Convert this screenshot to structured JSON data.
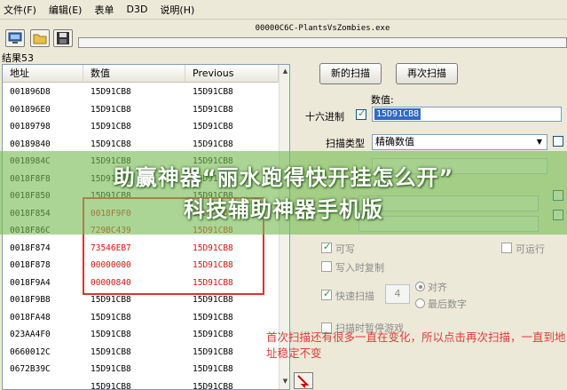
{
  "menu": [
    "文件(F)",
    "编辑(E)",
    "表单",
    "D3D",
    "说明(H)"
  ],
  "process_title": "00000C6C-PlantsVsZombies.exe",
  "result_count": "结果53",
  "columns": [
    "地址",
    "数值",
    "Previous"
  ],
  "rows": [
    [
      "001896D8",
      "15D91CB8",
      "15D91CB8"
    ],
    [
      "001896E0",
      "15D91CB8",
      "15D91CB8"
    ],
    [
      "00189798",
      "15D91CB8",
      "15D91CB8"
    ],
    [
      "00189840",
      "15D91CB8",
      "15D91CB8"
    ],
    [
      "0018984C",
      "15D91CB8",
      "15D91CB8"
    ],
    [
      "0018F8F8",
      "15D91CB8",
      "15D91CB8"
    ],
    [
      "0018F850",
      "15D91CB8",
      "15D91CB8"
    ],
    [
      "0018F854",
      "0018F9F0",
      "15D91CB8"
    ],
    [
      "0018F86C",
      "729BC439",
      "15D91CB8"
    ],
    [
      "0018F874",
      "73546EB7",
      "15D91CB8"
    ],
    [
      "0018F878",
      "00000000",
      "15D91CB8"
    ],
    [
      "0018F9A4",
      "00000840",
      "15D91CB8"
    ],
    [
      "0018F9B8",
      "15D91CB8",
      "15D91CB8"
    ],
    [
      "0018FA48",
      "15D91CB8",
      "15D91CB8"
    ],
    [
      "023AA4F0",
      "15D91CB8",
      "15D91CB8"
    ],
    [
      "0660012C",
      "15D91CB8",
      "15D91CB8"
    ],
    [
      "0672B39C",
      "15D91CB8",
      "15D91CB8"
    ],
    [
      "",
      "15D91CB8",
      "15D91CB8"
    ]
  ],
  "changed_rows": [
    7,
    8,
    9,
    10,
    11
  ],
  "buttons": {
    "new_scan": "新的扫描",
    "next_scan": "再次扫描"
  },
  "value_label": "数值:",
  "hex_label": "十六进制",
  "value": "15D91CB8",
  "scan_type_label": "扫描类型",
  "scan_type": "精确数值",
  "options": {
    "writable": "可写",
    "executable": "可运行",
    "copy_on_write": "写入时复制",
    "fast_scan": "快速扫描",
    "fast_scan_value": "4",
    "align": "对齐",
    "last_digits": "最后数字",
    "pause": "扫描时暂停游戏"
  },
  "banner": [
    "助赢神器“丽水跑得快开挂怎么开”",
    "科技辅助神器手机版"
  ],
  "note": "首次扫描还有很多一直在变化，所以点击再次扫描，一直到地址稳定不变",
  "colors": {
    "changed": "#d81010",
    "note": "#e03b3b",
    "banner": "#78bc54",
    "selection": "#316ac5"
  }
}
